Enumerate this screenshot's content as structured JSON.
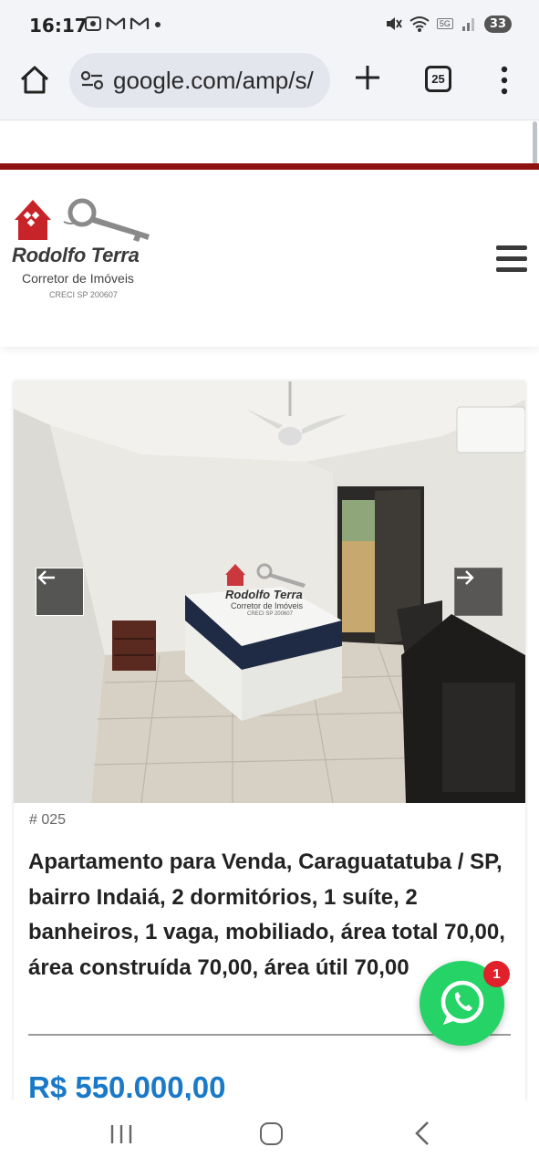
{
  "status_bar": {
    "time": "16:17",
    "battery": "33",
    "network": "5G"
  },
  "browser": {
    "url": "google.com/amp/s/",
    "tab_count": "25"
  },
  "header": {
    "logo_name": "Rodolfo Terra",
    "logo_subtitle": "Corretor de Imóveis",
    "logo_creci": "CRECI SP 200607"
  },
  "listing": {
    "ref": "# 025",
    "title": "Apartamento para Venda, Caraguatatuba / SP, bairro Indaiá, 2 dormitórios, 1 suíte, 2 banheiros, 1 vaga, mobiliado, área total 70,00, área construída 70,00, área útil 70,00",
    "price": "R$ 550.000,00",
    "price_color": "#1a7ac8"
  },
  "whatsapp": {
    "badge": "1",
    "color": "#25d366"
  },
  "accent_red": "#8f1213"
}
